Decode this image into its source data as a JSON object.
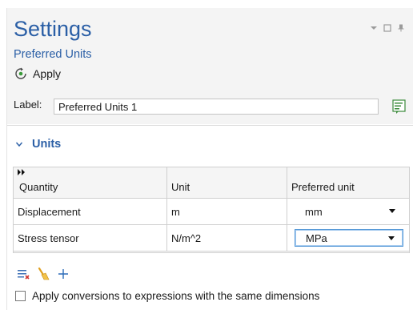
{
  "header": {
    "title": "Settings",
    "subtitle": "Preferred Units",
    "apply_label": "Apply"
  },
  "label_field": {
    "label": "Label:",
    "value": "Preferred Units 1"
  },
  "section": {
    "title": "Units"
  },
  "table": {
    "columns": [
      "Quantity",
      "Unit",
      "Preferred unit"
    ],
    "rows": [
      {
        "quantity": "Displacement",
        "unit": "m",
        "preferred": "mm"
      },
      {
        "quantity": "Stress tensor",
        "unit": "N/m^2",
        "preferred": "MPa"
      }
    ]
  },
  "toolbar": {
    "icons": [
      "clear-table-icon",
      "sweep-icon",
      "add-icon"
    ]
  },
  "checkbox": {
    "label": "Apply conversions to expressions with the same dimensions",
    "checked": false
  },
  "colors": {
    "accent": "#2b5fa6",
    "apply_icon": "#3a9a3a",
    "focus_border": "#5a9bd8"
  }
}
